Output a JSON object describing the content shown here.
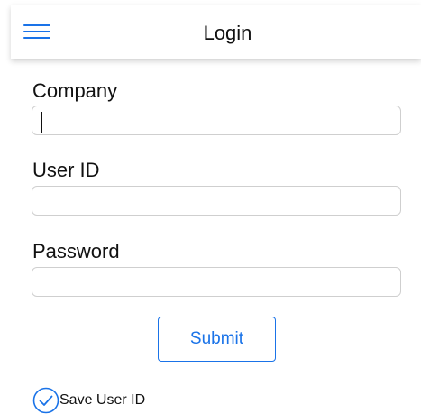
{
  "header": {
    "title": "Login",
    "menu_icon": "hamburger-menu-icon",
    "accent_color": "#1a73e8"
  },
  "form": {
    "company": {
      "label": "Company",
      "value": "",
      "placeholder": ""
    },
    "user_id": {
      "label": "User ID",
      "value": "",
      "placeholder": ""
    },
    "password": {
      "label": "Password",
      "value": "",
      "placeholder": ""
    },
    "submit_label": "Submit",
    "save_user_id": {
      "label": "Save User ID",
      "checked": true,
      "icon": "check-circle-icon"
    }
  }
}
